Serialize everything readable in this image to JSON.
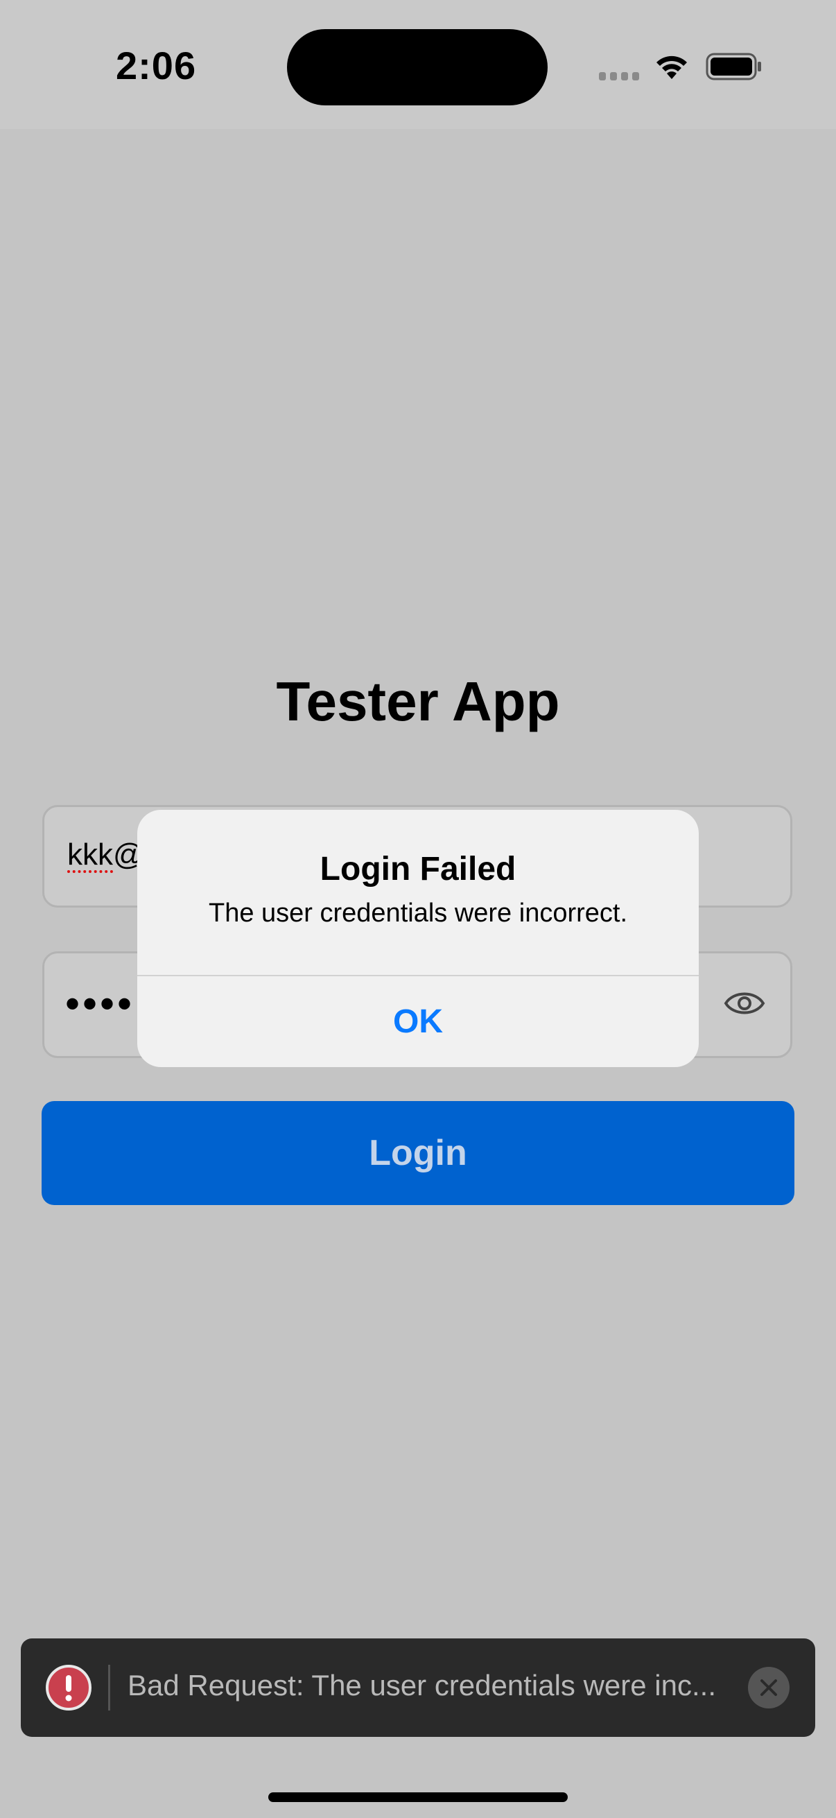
{
  "status_bar": {
    "time": "2:06",
    "icons": [
      "signal-dots-icon",
      "wifi-icon",
      "battery-icon"
    ]
  },
  "app": {
    "title": "Tester App"
  },
  "login_form": {
    "email_value_underlined": "kkk",
    "email_value_rest": "@",
    "password_value": "••••",
    "password_toggle_icon": "eye-icon",
    "login_button_label": "Login"
  },
  "alert": {
    "title": "Login Failed",
    "message": "The user credentials were incorrect.",
    "ok_label": "OK"
  },
  "toast": {
    "icon": "error-icon",
    "message": "Bad Request: The user credentials were inc...",
    "close_icon": "close-icon"
  },
  "colors": {
    "accent": "#0062cf",
    "alert_action": "#0a7aff",
    "error": "#c9404e",
    "toast_background": "#2a2a2a"
  }
}
